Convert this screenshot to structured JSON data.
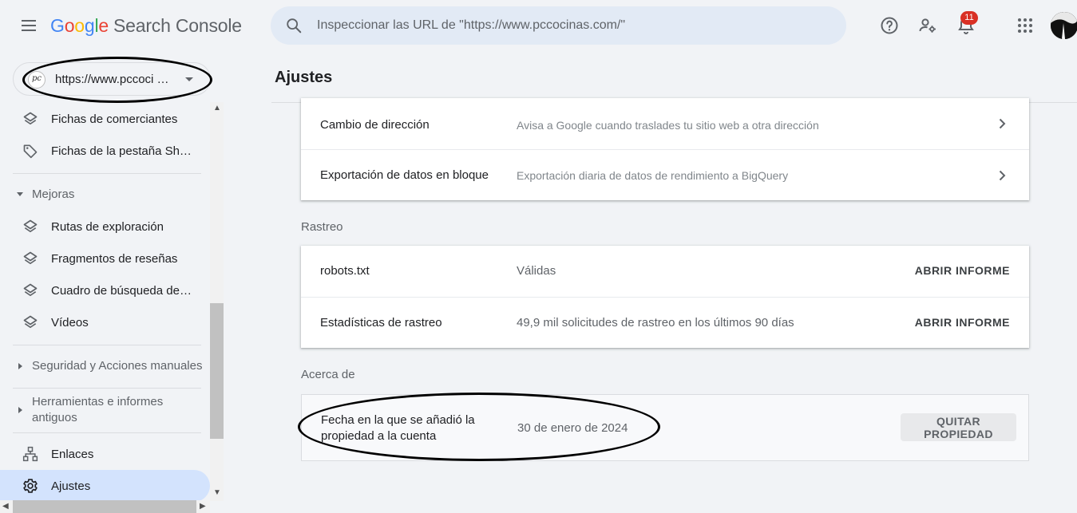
{
  "app": {
    "logo_letters": [
      "G",
      "o",
      "o",
      "g",
      "l",
      "e"
    ],
    "logo_rest": "Search Console"
  },
  "search": {
    "placeholder": "Inspeccionar las URL de \"https://www.pccocinas.com/\""
  },
  "header": {
    "notifications_count": "11",
    "icons": [
      "help-icon",
      "manage-users-icon",
      "notifications-icon",
      "apps-grid-icon",
      "avatar"
    ]
  },
  "property": {
    "logo_text": "pc",
    "url": "https://www.pccoci …"
  },
  "sidebar": {
    "items": [
      {
        "label": "Fichas de comerciantes",
        "icon": "layers-icon"
      },
      {
        "label": "Fichas de la pestaña Sh…",
        "icon": "tag-icon"
      },
      {
        "label": "Mejoras",
        "type": "section"
      },
      {
        "label": "Rutas de exploración",
        "icon": "layers-icon"
      },
      {
        "label": "Fragmentos de reseñas",
        "icon": "layers-icon"
      },
      {
        "label": "Cuadro de búsqueda de…",
        "icon": "layers-icon"
      },
      {
        "label": "Vídeos",
        "icon": "layers-icon"
      },
      {
        "label": "Seguridad y Acciones manuales",
        "type": "section"
      },
      {
        "label": "Herramientas e informes antiguos",
        "type": "section"
      },
      {
        "label": "Enlaces",
        "icon": "links-icon"
      },
      {
        "label": "Ajustes",
        "icon": "gear-icon",
        "active": true
      }
    ]
  },
  "main": {
    "title": "Ajustes",
    "general": [
      {
        "name": "Cambio de dirección",
        "desc": "Avisa a Google cuando traslades tu sitio web a otra dirección"
      },
      {
        "name": "Exportación de datos en bloque",
        "desc": "Exportación diaria de datos de rendimiento a BigQuery"
      }
    ],
    "crawl_label": "Rastreo",
    "crawl": [
      {
        "name": "robots.txt",
        "desc": "Válidas",
        "action": "ABRIR INFORME"
      },
      {
        "name": "Estadísticas de rastreo",
        "desc": "49,9 mil solicitudes de rastreo en los últimos 90 días",
        "action": "ABRIR INFORME"
      }
    ],
    "about_label": "Acerca de",
    "about": {
      "name": "Fecha en la que se añadió la propiedad a la cuenta",
      "value": "30 de enero de 2024",
      "button": "QUITAR PROPIEDAD"
    }
  },
  "colors": {
    "accent_active": "#d3e3fd",
    "badge": "#d93025",
    "search_bg": "#e2eaf5"
  }
}
